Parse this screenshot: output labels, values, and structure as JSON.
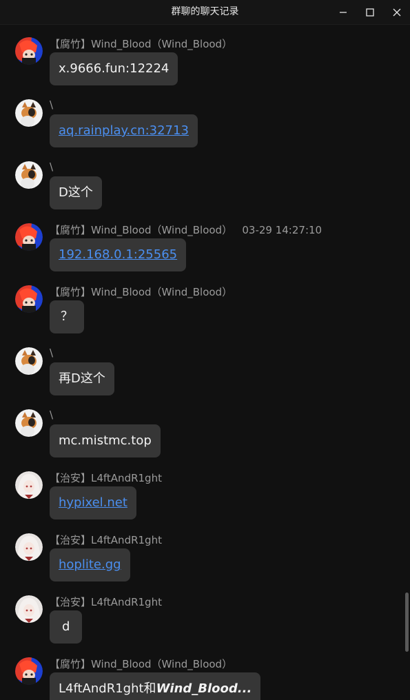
{
  "window": {
    "title": "群聊的聊天记录"
  },
  "messages": [
    {
      "sender": "【腐竹】Wind_Blood（Wind_Blood）",
      "text": "x.9666.fun:12224",
      "is_link": false,
      "avatar": "red-hair-avatar"
    },
    {
      "sender": "\\",
      "text": "aq.rainplay.cn:32713",
      "is_link": true,
      "avatar": "cat-avatar"
    },
    {
      "sender": "\\",
      "text": "D这个",
      "is_link": false,
      "avatar": "cat-avatar"
    },
    {
      "sender": "【腐竹】Wind_Blood（Wind_Blood）   03-29 14:27:10",
      "text": "192.168.0.1:25565",
      "is_link": true,
      "avatar": "red-hair-avatar"
    },
    {
      "sender": "【腐竹】Wind_Blood（Wind_Blood）",
      "text": "？",
      "is_link": false,
      "avatar": "red-hair-avatar"
    },
    {
      "sender": "\\",
      "text": "再D这个",
      "is_link": false,
      "avatar": "cat-avatar"
    },
    {
      "sender": "\\",
      "text": "mc.mistmc.top",
      "is_link": false,
      "avatar": "cat-avatar"
    },
    {
      "sender": "【治安】L4ftAndR1ght",
      "text": "hypixel.net",
      "is_link": true,
      "avatar": "white-hair-avatar"
    },
    {
      "sender": "【治安】L4ftAndR1ght",
      "text": "hoplite.gg",
      "is_link": true,
      "avatar": "white-hair-avatar"
    },
    {
      "sender": "【治安】L4ftAndR1ght",
      "text": "d",
      "is_link": false,
      "avatar": "white-hair-avatar"
    },
    {
      "sender": "【腐竹】Wind_Blood（Wind_Blood）",
      "text": "L4ftAndR1ght和",
      "text_bold": "Wind_Blood...",
      "is_link": false,
      "avatar": "red-hair-avatar"
    }
  ],
  "colors": {
    "background": "#111111",
    "bubble": "#363636",
    "link": "#4b8ff0",
    "sender": "#9b9b9b"
  }
}
